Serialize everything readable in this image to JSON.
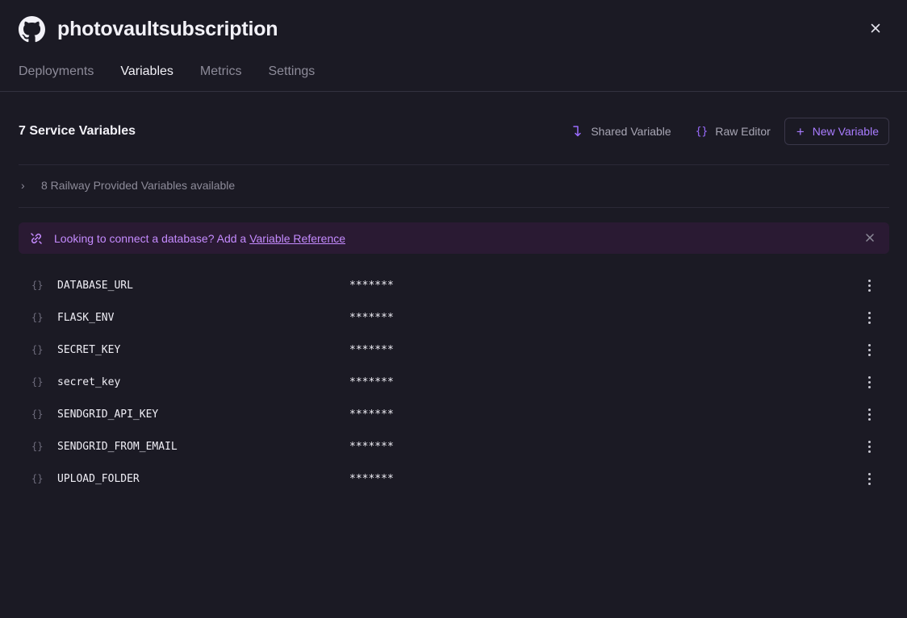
{
  "header": {
    "title": "photovaultsubscription",
    "logo_icon": "github-icon",
    "close_icon": "close-icon"
  },
  "tabs": [
    {
      "label": "Deployments",
      "active": false
    },
    {
      "label": "Variables",
      "active": true
    },
    {
      "label": "Metrics",
      "active": false
    },
    {
      "label": "Settings",
      "active": false
    }
  ],
  "section": {
    "title": "7 Service Variables",
    "shared_variable_label": "Shared Variable",
    "raw_editor_label": "Raw Editor",
    "raw_editor_icon_text": "{}",
    "new_variable_label": "New Variable",
    "new_variable_icon_text": "+"
  },
  "provided": {
    "label": "8 Railway Provided Variables available",
    "chevron_text": "›"
  },
  "banner": {
    "message": "Looking to connect a database? Add a",
    "link_label": "Variable Reference"
  },
  "variables": [
    {
      "name": "DATABASE_URL",
      "value": "*******"
    },
    {
      "name": "FLASK_ENV",
      "value": "*******"
    },
    {
      "name": "SECRET_KEY",
      "value": "*******"
    },
    {
      "name": "secret_key",
      "value": "*******"
    },
    {
      "name": "SENDGRID_API_KEY",
      "value": "*******"
    },
    {
      "name": "SENDGRID_FROM_EMAIL",
      "value": "*******"
    },
    {
      "name": "UPLOAD_FOLDER",
      "value": "*******"
    }
  ],
  "row_icon_text": "{}",
  "colors": {
    "background": "#1b1a24",
    "accent": "#a97cff",
    "banner_bg": "#2a1a33",
    "banner_text": "#c58bff"
  }
}
